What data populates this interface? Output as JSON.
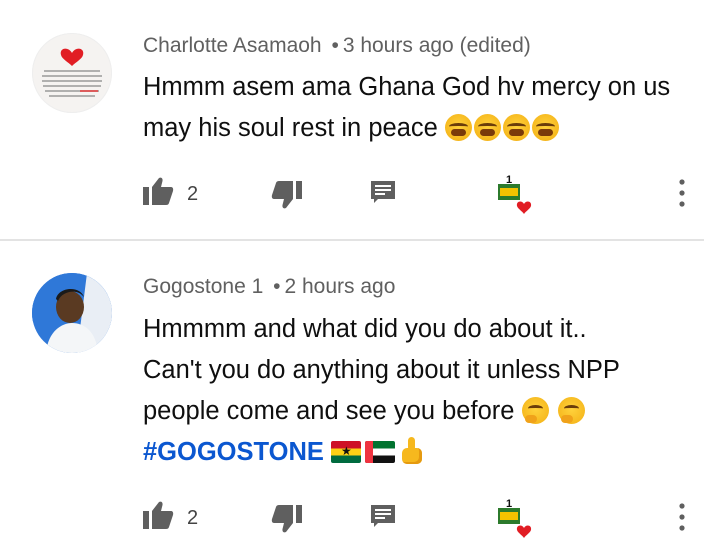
{
  "comments": [
    {
      "author": "Charlotte Asamaoh",
      "separator": "•",
      "time": "3 hours ago",
      "edited": "(edited)",
      "text": "Hmmm asem ama Ghana God hv mercy on us may his soul rest in peace",
      "emojis": [
        "crying-face",
        "crying-face",
        "crying-face",
        "crying-face"
      ],
      "likes": "2",
      "avatar": "heart-quote-image"
    },
    {
      "author": "Gogostone 1",
      "separator": "•",
      "time": "2 hours ago",
      "text_line1": "Hmmmm and what did you do about it..",
      "text_line2": "Can't you do anything about it unless NPP",
      "text_line3": "people come and see you before",
      "hashtag": "#GOGOSTONE",
      "emojis": [
        "thinking-face",
        "thinking-face",
        "ghana-flag",
        "uae-flag",
        "thumbs-up"
      ],
      "likes": "2",
      "avatar": "profile-photo"
    }
  ],
  "colors": {
    "meta_text": "#606060",
    "hashtag": "#0b57d0",
    "icon": "#5f5f5f",
    "heart": "#e11d24"
  }
}
